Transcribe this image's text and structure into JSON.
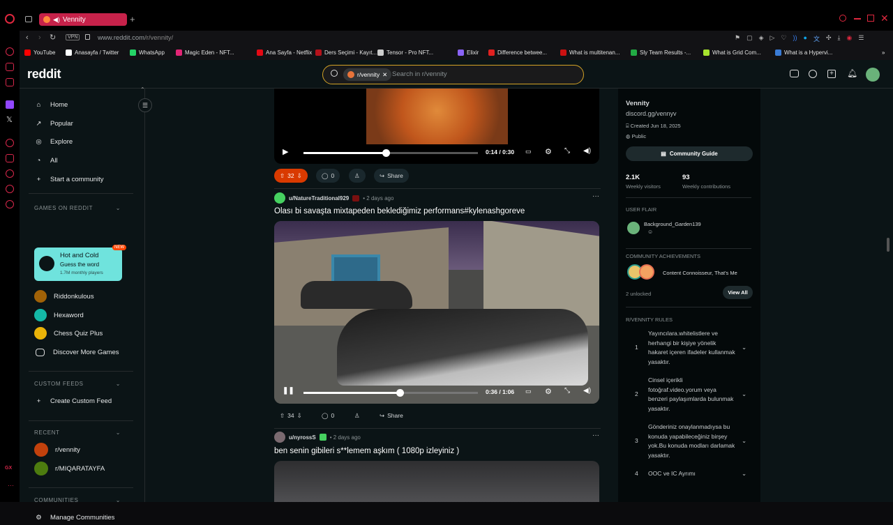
{
  "browser": {
    "tab_title": "Vennity",
    "url_prefix": "www.reddit.com",
    "url_path": "/r/vennity/",
    "vpn_label": "VPN",
    "bookmarks": [
      {
        "label": "YouTube",
        "color": "#ff0000"
      },
      {
        "label": "Anasayfa / Twitter",
        "color": "#ffffff"
      },
      {
        "label": "WhatsApp",
        "color": "#25d366"
      },
      {
        "label": "Magic Eden - NFT...",
        "color": "#e42575"
      },
      {
        "label": "Ana Sayfa - Netflix",
        "color": "#e50914"
      },
      {
        "label": "Ders Seçimi - Kayıt...",
        "color": "#b5121b"
      },
      {
        "label": "Tensor - Pro NFT...",
        "color": "#cccccc"
      },
      {
        "label": "Elixir",
        "color": "#8a63f6"
      },
      {
        "label": "Difference betwee...",
        "color": "#e02020"
      },
      {
        "label": "What is multitenan...",
        "color": "#cc1111"
      },
      {
        "label": "Sly Team Results -...",
        "color": "#22aa44"
      },
      {
        "label": "What is Grid Com...",
        "color": "#a6e22e"
      },
      {
        "label": "What is a Hypervi...",
        "color": "#3a7bd5"
      }
    ]
  },
  "reddit": {
    "logo": "reddit",
    "search": {
      "chip": "r/vennity",
      "placeholder": "Search in r/vennity"
    },
    "nav": {
      "home": "Home",
      "popular": "Popular",
      "explore": "Explore",
      "all": "All",
      "start_community": "Start a community"
    },
    "games": {
      "header": "GAMES ON REDDIT",
      "featured": {
        "title": "Hot and Cold",
        "subtitle": "Guess the word",
        "players": "1.7M monthly players",
        "badge": "NEW"
      },
      "items": [
        "Riddonkulous",
        "Hexaword",
        "Chess Quiz Plus",
        "Discover More Games"
      ]
    },
    "custom_feeds": {
      "header": "CUSTOM FEEDS",
      "create": "Create Custom Feed"
    },
    "recent": {
      "header": "RECENT",
      "items": [
        "r/vennity",
        "r/MIQARATAYFA"
      ]
    },
    "communities": {
      "header": "COMMUNITIES",
      "manage": "Manage Communities"
    }
  },
  "feed": {
    "post1": {
      "time": "0:14 / 0:30",
      "progress": 0.47,
      "votes": "32",
      "comments": "0",
      "share": "Share"
    },
    "post2": {
      "author": "u/NatureTraditional929",
      "time_ago": "• 2 days ago",
      "title": "Olası bi savaşta mixtapeden beklediğimiz performans#kylenashgoreve",
      "video_time": "0:36 / 1:06",
      "progress": 0.55,
      "votes": "34",
      "comments": "0",
      "share": "Share"
    },
    "post3": {
      "author": "u/nyrossS",
      "time_ago": "• 2 days ago",
      "title": "ben senin gibileri s**lemem aşkım ( 1080p izleyiniz )"
    }
  },
  "sidebar": {
    "name": "Vennity",
    "link": "discord.gg/vennyv",
    "created": "Created Jun 18, 2025",
    "visibility": "Public",
    "guide_button": "Community Guide",
    "visitors_value": "2.1K",
    "visitors_label": "Weekly visitors",
    "contrib_value": "93",
    "contrib_label": "Weekly contributions",
    "user_flair_header": "USER FLAIR",
    "flair_user": "Background_Garden139",
    "achievements_header": "COMMUNITY ACHIEVEMENTS",
    "achievements_text": "Content Connoisseur, That's Me",
    "unlocked": "2 unlocked",
    "view_all": "View All",
    "rules_header": "R/VENNITY RULES",
    "rules": [
      {
        "n": "1",
        "text": "Yayıncılara.whitelistlere ve herhangi bir kişiye yönelik hakaret içeren ifadeler kullanmak yasaktır."
      },
      {
        "n": "2",
        "text": "Cinsel içerikli fotoğraf.video.yorum veya benzeri paylaşımlarda bulunmak yasaktır."
      },
      {
        "n": "3",
        "text": "Gönderiniz onaylanmadıysa bu konuda yapabileceğiniz birşey yok.Bu konuda modları darlamak yasaktır."
      },
      {
        "n": "4",
        "text": "OOC ve IC Ayrımı"
      }
    ]
  }
}
